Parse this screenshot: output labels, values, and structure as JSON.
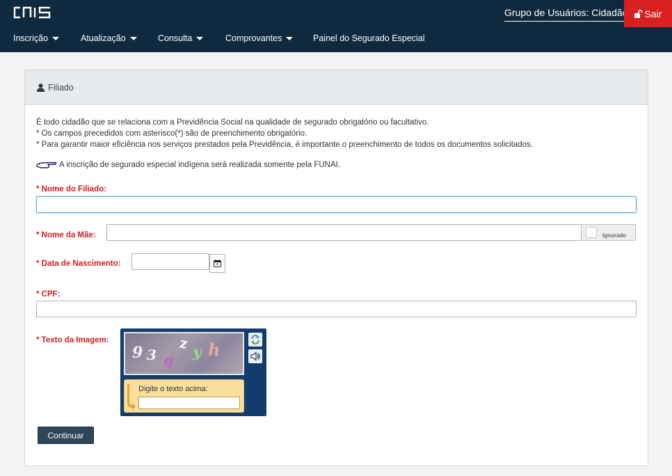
{
  "header": {
    "logo_text": "CNIS",
    "user_group": "Grupo de Usuários: Cidadão",
    "logout_label": "Sair",
    "logout_icon": "unlock-icon",
    "nav": [
      {
        "label": "Inscrição",
        "has_dropdown": true
      },
      {
        "label": "Atualização",
        "has_dropdown": true
      },
      {
        "label": "Consulta",
        "has_dropdown": true
      },
      {
        "label": "Comprovantes",
        "has_dropdown": true
      },
      {
        "label": "Painel do Segurado Especial",
        "has_dropdown": false
      }
    ]
  },
  "panel": {
    "title": "Filiado",
    "title_icon": "user-icon",
    "info_lines": [
      "É todo cidadão que se relaciona com a Previdência Social na qualidade de segurado obrigatório ou facultativo.",
      "* Os campos precedidos com asterisco(*) são de preenchimento obrigatório.",
      "* Para garantir maior eficiência nos serviços prestados pela Previdência, é importante o preenchimento de todos os documentos solicitados."
    ],
    "funai_note": "A inscrição de segurado especial indígena será realizada somente pela FUNAI.",
    "funai_icon": "pointing-hand-icon"
  },
  "form": {
    "nome_filiado": {
      "label": "* Nome do Filiado:",
      "value": ""
    },
    "nome_mae": {
      "label": "* Nome da Mãe:",
      "value": "",
      "ignorado_label": "Ignorado",
      "ignorado_checked": false
    },
    "data_nascimento": {
      "label": "* Data de Nascimento:",
      "value": "",
      "calendar_icon": "calendar-icon"
    },
    "cpf": {
      "label": "* CPF:",
      "value": ""
    },
    "captcha": {
      "label": "* Texto da Imagem:",
      "chars": [
        "9",
        "3",
        "q",
        "z",
        "y",
        "h"
      ],
      "prompt": "Digite o texto acima:",
      "value": "",
      "refresh_icon": "refresh-icon",
      "audio_icon": "speaker-icon"
    },
    "submit_label": "Continuar"
  },
  "colors": {
    "header_bg": "#0f2a3f",
    "logout_bg": "#d9201f",
    "required_label": "#d21d1d",
    "submit_bg": "#2f4558",
    "captcha_bg": "#143d6e"
  }
}
